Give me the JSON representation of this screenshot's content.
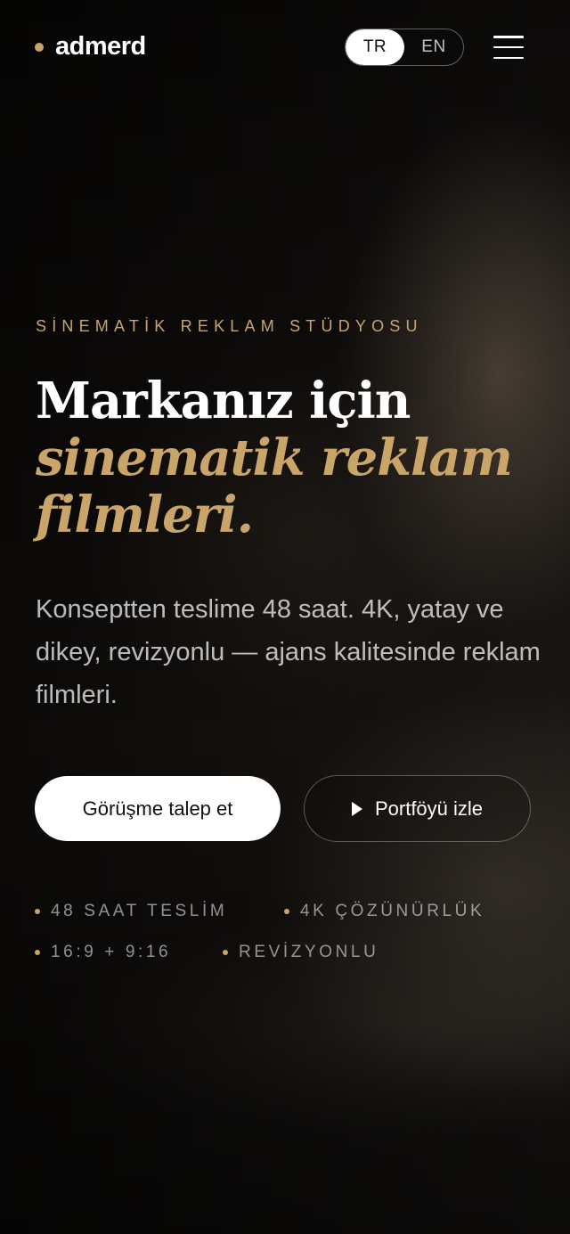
{
  "header": {
    "logo": "admerd",
    "languages": [
      {
        "label": "TR",
        "active": true
      },
      {
        "label": "EN",
        "active": false
      }
    ]
  },
  "hero": {
    "eyebrow": "SİNEMATİK REKLAM STÜDYOSU",
    "headline_line1": "Markanız için",
    "headline_line2": "sinematik reklam",
    "headline_line3": "filmleri.",
    "lead": "Konseptten teslime 48 saat. 4K, yatay ve dikey, revizyonlu — ajans kalitesinde reklam filmleri.",
    "primary_cta": "Görüşme talep et",
    "secondary_cta": "Portföyü izle",
    "features": [
      "48 SAAT TESLİM",
      "4K ÇÖZÜNÜRLÜK",
      "16:9 + 9:16",
      "REVİZYONLU"
    ]
  },
  "colors": {
    "accent": "#c9a56a",
    "background": "#0a0908",
    "text": "#ffffff"
  },
  "icons": {
    "menu": "hamburger-menu-icon",
    "play": "play-icon"
  }
}
